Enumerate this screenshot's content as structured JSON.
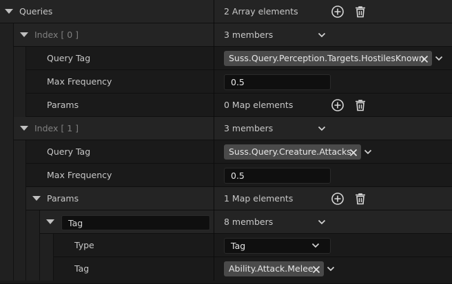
{
  "colors": {
    "bg": "#151515",
    "row_dark": "#1a1a1a",
    "row_light": "#242424",
    "chip": "#4a4a4a",
    "text": "#c8c8c8",
    "dim_text": "#808080"
  },
  "queries": {
    "label": "Queries",
    "value": "2 Array elements",
    "add_icon": "add-circle-icon",
    "delete_icon": "trash-icon"
  },
  "index0": {
    "label": "Index [ 0 ]",
    "value": "3 members",
    "query_tag_label": "Query Tag",
    "query_tag_value": "Suss.Query.Perception.Targets.HostilesKnown",
    "max_freq_label": "Max Frequency",
    "max_freq_value": "0.5",
    "params_label": "Params",
    "params_value": "0 Map elements"
  },
  "index1": {
    "label": "Index [ 1 ]",
    "value": "3 members",
    "query_tag_label": "Query Tag",
    "query_tag_value": "Suss.Query.Creature.Attacks",
    "max_freq_label": "Max Frequency",
    "max_freq_value": "0.5",
    "params_label": "Params",
    "params_value": "1 Map elements",
    "entry": {
      "key_value": "Tag",
      "value": "8 members",
      "type_label": "Type",
      "type_value": "Tag",
      "tag_label": "Tag",
      "tag_value": "Ability.Attack.Melee"
    }
  }
}
